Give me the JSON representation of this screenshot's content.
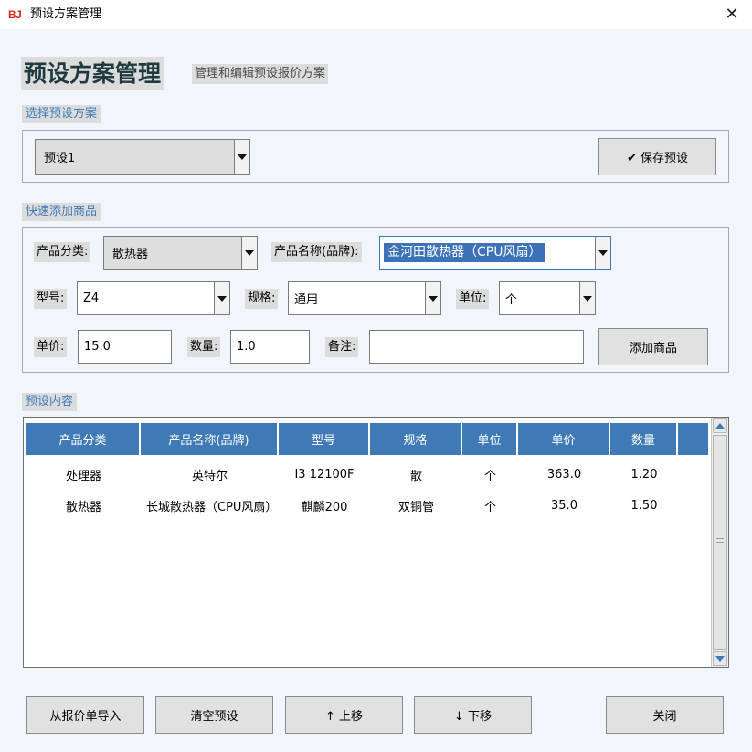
{
  "window": {
    "icon_text": "BJ",
    "title": "预设方案管理",
    "close_glyph": "✕"
  },
  "header": {
    "title": "预设方案管理",
    "subtitle": "管理和编辑预设报价方案"
  },
  "preset_section": {
    "label": "选择预设方案",
    "selected_preset": "预设1",
    "save_button": "✔ 保存预设"
  },
  "quick_add": {
    "label": "快速添加商品",
    "category_label": "产品分类:",
    "category_value": "散热器",
    "name_label": "产品名称(品牌):",
    "name_value": "金河田散热器（CPU风扇）",
    "model_label": "型号:",
    "model_value": "Z4",
    "spec_label": "规格:",
    "spec_value": "通用",
    "unit_label": "单位:",
    "unit_value": "个",
    "price_label": "单价:",
    "price_value": "15.0",
    "qty_label": "数量:",
    "qty_value": "1.0",
    "note_label": "备注:",
    "note_value": "",
    "add_button": "添加商品"
  },
  "content_section": {
    "label": "预设内容",
    "columns": [
      "产品分类",
      "产品名称(品牌)",
      "型号",
      "规格",
      "单位",
      "单价",
      "数量"
    ],
    "rows": [
      [
        "处理器",
        "英特尔",
        "I3 12100F",
        "散",
        "个",
        "363.0",
        "1.20"
      ],
      [
        "散热器",
        "长城散热器（CPU风扇）",
        "麒麟200",
        "双铜管",
        "个",
        "35.0",
        "1.50"
      ]
    ]
  },
  "footer": {
    "import_button": "从报价单导入",
    "clear_button": "清空预设",
    "up_button": "↑ 上移",
    "down_button": "↓ 下移",
    "close_button": "关闭"
  },
  "colors": {
    "accent": "#3f7ab6",
    "header_bg": "#3f7ab6",
    "window_bg": "#f0f6fc",
    "icon_red": "#d12a1f"
  }
}
